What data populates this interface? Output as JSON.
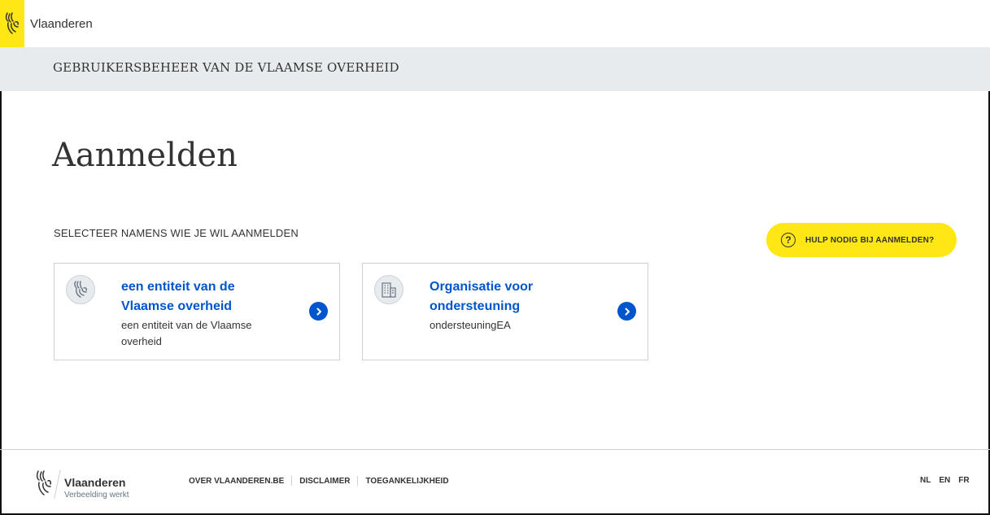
{
  "header": {
    "brand": "Vlaanderen",
    "app_title": "GEBRUIKERSBEHEER VAN DE VLAAMSE OVERHEID"
  },
  "main": {
    "title": "Aanmelden",
    "section_label": "SELECTEER NAMENS WIE JE WIL AANMELDEN",
    "help_button": "HULP NODIG BIJ AANMELDEN?",
    "help_icon_glyph": "?",
    "cards": [
      {
        "title": "een entiteit van de Vlaamse overheid",
        "subtitle": "een entiteit van de Vlaamse overheid",
        "icon": "flemish-lion-icon"
      },
      {
        "title": "Organisatie voor ondersteuning",
        "subtitle": "ondersteuningEA",
        "icon": "building-icon"
      }
    ]
  },
  "footer": {
    "brand": "Vlaanderen",
    "tagline": "Verbeelding werkt",
    "links": [
      "OVER VLAANDEREN.BE",
      "DISCLAIMER",
      "TOEGANKELIJKHEID"
    ],
    "languages": [
      "NL",
      "EN",
      "FR"
    ]
  },
  "colors": {
    "accent_yellow": "#ffe615",
    "link_blue": "#0055cc",
    "band_gray": "#e8ebee",
    "border_gray": "#cbd2da"
  }
}
